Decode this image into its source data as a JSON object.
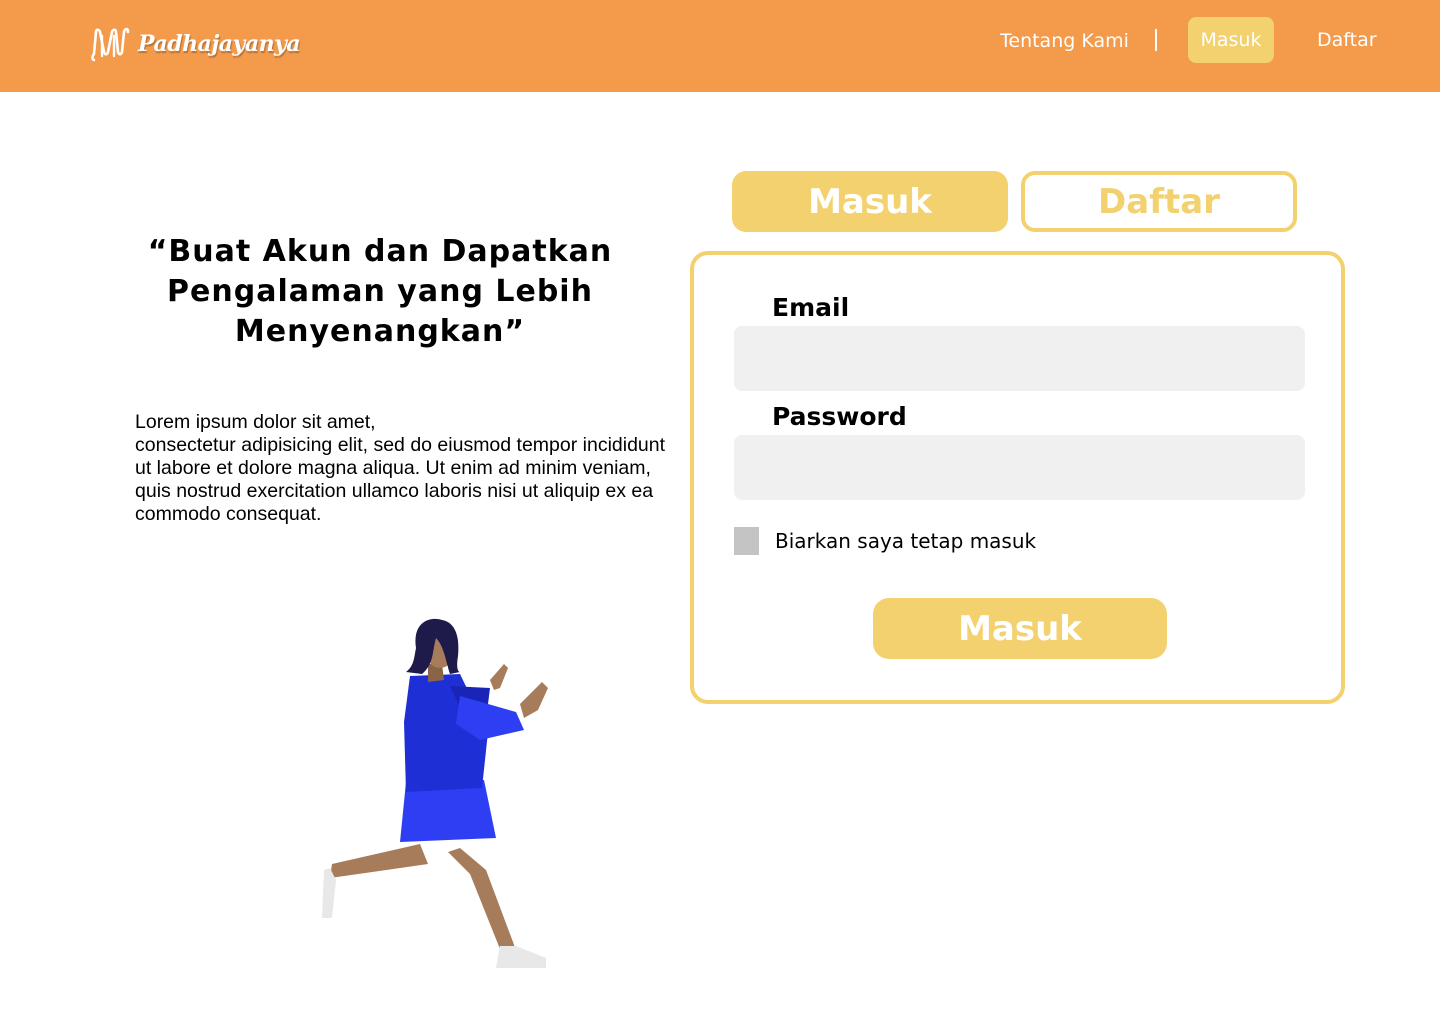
{
  "header": {
    "brand": "Padhajayanya",
    "nav": {
      "about": "Tentang Kami",
      "login": "Masuk",
      "register": "Daftar"
    }
  },
  "hero": {
    "headline": "“Buat Akun dan Dapatkan Pengalaman yang Lebih Menyenangkan”",
    "body": "Lorem ipsum dolor sit amet,\nconsectetur adipisicing elit, sed do eiusmod tempor incididunt ut labore et dolore magna aliqua. Ut enim ad minim veniam,\nquis nostrud exercitation ullamco laboris nisi ut aliquip ex ea commodo consequat."
  },
  "tabs": {
    "login": "Masuk",
    "register": "Daftar"
  },
  "form": {
    "email_label": "Email",
    "email_value": "",
    "password_label": "Password",
    "password_value": "",
    "remember_label": "Biarkan saya tetap masuk",
    "remember_checked": false,
    "submit_label": "Masuk"
  },
  "colors": {
    "header_bg": "#F39A4B",
    "accent": "#F3D16E",
    "input_bg": "#F0F0F0",
    "checkbox": "#C4C4C4"
  },
  "icons": {
    "logo": "brand-logo-icon"
  }
}
